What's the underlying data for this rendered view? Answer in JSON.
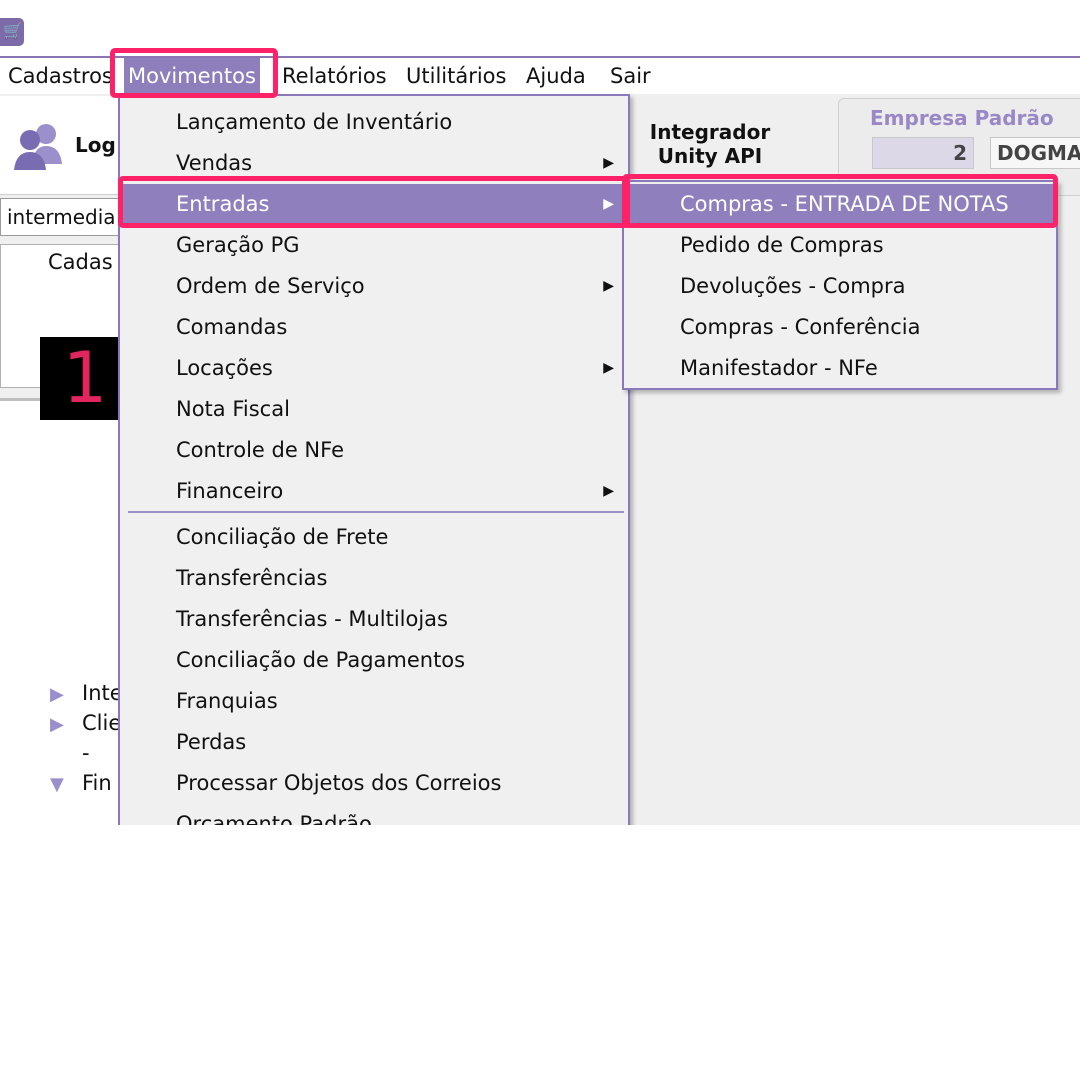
{
  "menubar": {
    "items": [
      "Cadastros",
      "Movimentos",
      "Relatórios",
      "Utilitários",
      "Ajuda",
      "Sair"
    ],
    "active": "Movimentos"
  },
  "header": {
    "user_label": "Log",
    "integrador_line1": "Integrador",
    "integrador_line2": "Unity API",
    "empresa_label": "Empresa Padrão",
    "empresa_number": "2",
    "empresa_name": "DOGMA"
  },
  "left": {
    "search_value": "intermedia",
    "panel_label": "Cadas",
    "tree": [
      {
        "icon": "triangle-right-icon",
        "label": "Inte"
      },
      {
        "icon": "triangle-right-icon",
        "label": "Clie"
      },
      {
        "icon": "",
        "label": "-"
      },
      {
        "icon": "triangle-down-icon",
        "label": "Fin"
      }
    ]
  },
  "badge": "1",
  "dropdown": {
    "items": [
      {
        "label": "Lançamento de Inventário",
        "submenu": false
      },
      {
        "label": "Vendas",
        "submenu": true
      },
      {
        "label": "Entradas",
        "submenu": true,
        "selected": true
      },
      {
        "label": "Geração PG",
        "submenu": false
      },
      {
        "label": "Ordem de Serviço",
        "submenu": true
      },
      {
        "label": "Comandas",
        "submenu": false
      },
      {
        "label": "Locações",
        "submenu": true
      },
      {
        "label": "Nota Fiscal",
        "submenu": false
      },
      {
        "label": "Controle de NFe",
        "submenu": false
      },
      {
        "label": "Financeiro",
        "submenu": true
      },
      {
        "label": "Conciliação de Frete",
        "submenu": false
      },
      {
        "label": "Transferências",
        "submenu": false
      },
      {
        "label": "Transferências - Multilojas",
        "submenu": false
      },
      {
        "label": "Conciliação de Pagamentos",
        "submenu": false
      },
      {
        "label": "Franquias",
        "submenu": false
      },
      {
        "label": "Perdas",
        "submenu": false
      },
      {
        "label": "Processar Objetos dos Correios",
        "submenu": false
      },
      {
        "label": "Orçamento Padrão",
        "submenu": false
      }
    ]
  },
  "submenu": {
    "items": [
      {
        "label": "Compras - ENTRADA DE NOTAS",
        "selected": true
      },
      {
        "label": "Pedido de Compras"
      },
      {
        "label": "Devoluções - Compra"
      },
      {
        "label": "Compras - Conferência"
      },
      {
        "label": "Manifestador - NFe"
      }
    ]
  },
  "colors": {
    "accent": "#8f80bd",
    "highlight": "#ff2268",
    "badge_text": "#e0255f"
  }
}
